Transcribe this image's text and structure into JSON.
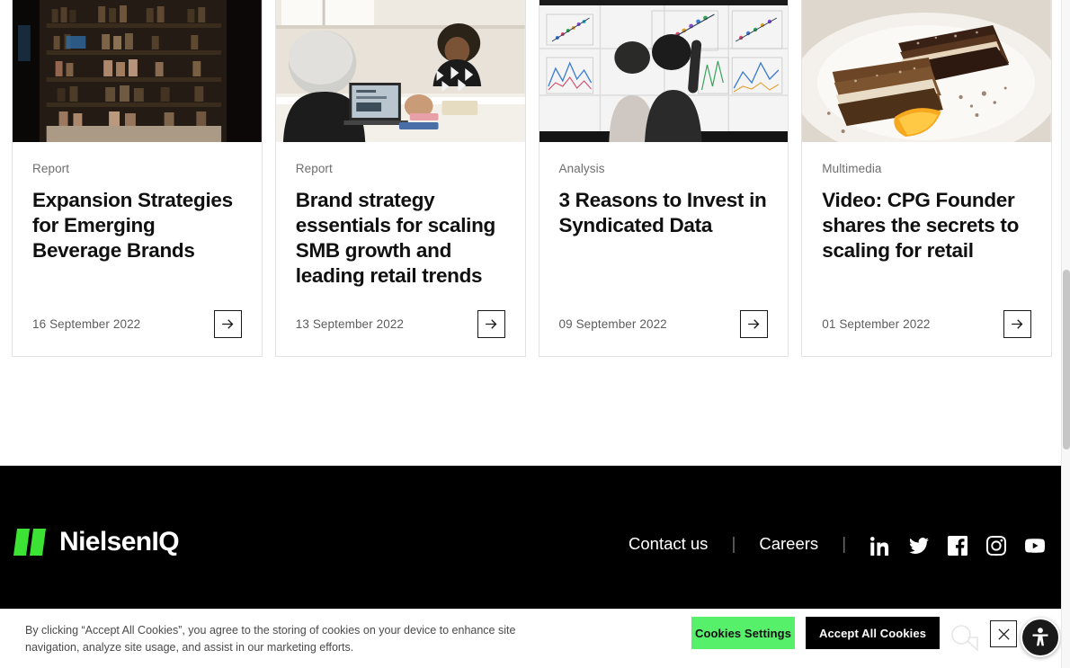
{
  "cards": [
    {
      "kicker": "Report",
      "title": "Expansion Strategies for Emerging Beverage Brands",
      "date": "16 September 2022",
      "image_name": "beverage-store-shelves-photo",
      "arrow_label": "→"
    },
    {
      "kicker": "Report",
      "title": "Brand strategy essentials for scaling SMB growth and leading retail trends",
      "date": "13 September 2022",
      "image_name": "office-meeting-discussion-photo",
      "arrow_label": "→"
    },
    {
      "kicker": "Analysis",
      "title": "3 Reasons to Invest in Syndicated Data",
      "date": "09 September 2022",
      "image_name": "analysts-viewing-data-wall-photo",
      "arrow_label": "→"
    },
    {
      "kicker": "Multimedia",
      "title": "Video: CPG Founder shares the secrets to scaling for retail",
      "date": "01 September 2022",
      "image_name": "chocolate-bars-on-plate-photo",
      "arrow_label": "→"
    }
  ],
  "footer": {
    "logo_text": "NielsenIQ",
    "logo_mark_name": "nielseniq-parallelogram-mark",
    "separator": "|",
    "links": [
      {
        "label": "Contact us"
      },
      {
        "label": "Careers"
      }
    ],
    "socials": [
      {
        "name": "linkedin-icon",
        "label": "LinkedIn"
      },
      {
        "name": "twitter-icon",
        "label": "Twitter"
      },
      {
        "name": "facebook-icon",
        "label": "Facebook"
      },
      {
        "name": "instagram-icon",
        "label": "Instagram"
      },
      {
        "name": "youtube-icon",
        "label": "YouTube"
      }
    ]
  },
  "cookie_banner": {
    "text": "By clicking “Accept All Cookies”, you agree to the storing of cookies on your device to enhance site navigation, analyze site usage, and assist in our marketing efforts.",
    "settings_label": "Cookies Settings",
    "accept_label": "Accept All Cookies",
    "close_icon_name": "close-icon",
    "accessibility_icon_name": "accessibility-icon",
    "ghost_icon_name": "search-icon"
  },
  "colors": {
    "footer_background": "#000000",
    "logo_green": "#3ce234",
    "cookies_settings_green": "#56f06a",
    "accept_black": "#000000",
    "card_border": "#e3e3e3",
    "text_primary": "#101010",
    "text_muted": "#6e6e6e"
  }
}
